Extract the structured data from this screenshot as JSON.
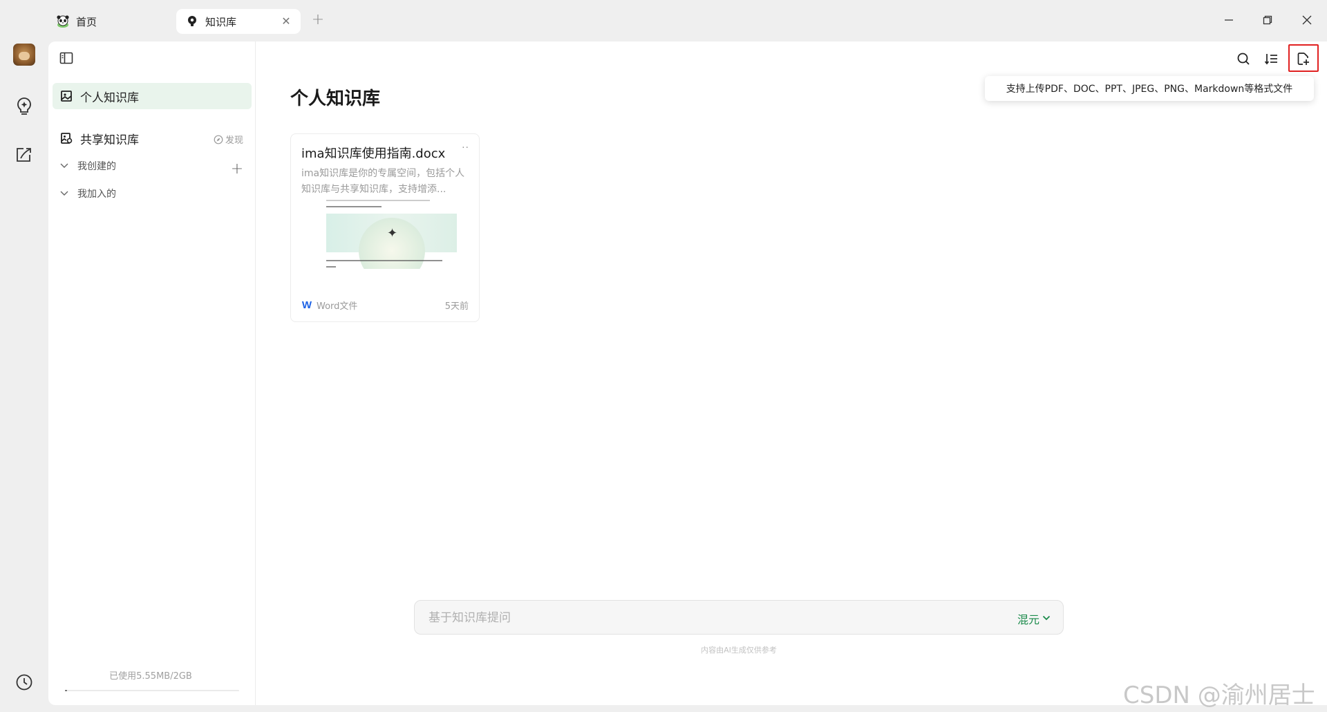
{
  "tabs": [
    {
      "label": "首页",
      "icon": "panda-icon",
      "active": false
    },
    {
      "label": "知识库",
      "icon": "bulb-icon",
      "active": true
    }
  ],
  "window_controls": [
    "minimize",
    "restore",
    "close"
  ],
  "sidebar": {
    "personal_kb": "个人知识库",
    "shared_kb": "共享知识库",
    "discover": "发现",
    "created_by_me": "我创建的",
    "joined_by_me": "我加入的",
    "usage": "已使用5.55MB/2GB",
    "usage_fraction": 0.0027
  },
  "main": {
    "title": "个人知识库",
    "upload_tooltip": "支持上传PDF、DOC、PPT、JPEG、PNG、Markdown等格式文件",
    "card": {
      "title": "ima知识库使用指南.docx",
      "more": "··",
      "description": "ima知识库是你的专属空间，包括个人知识库与共享知识库，支持增添...",
      "file_type": "Word文件",
      "time": "5天前"
    },
    "ask": {
      "placeholder": "基于知识库提问",
      "model": "混元"
    },
    "ai_note": "内容由AI生成仅供参考"
  },
  "watermark": "CSDN @渝州居士",
  "colors": {
    "accent_green": "#1a8a4a",
    "active_bg": "#e9f4ec",
    "highlight_red": "#e02020",
    "word_blue": "#1e63e6"
  }
}
